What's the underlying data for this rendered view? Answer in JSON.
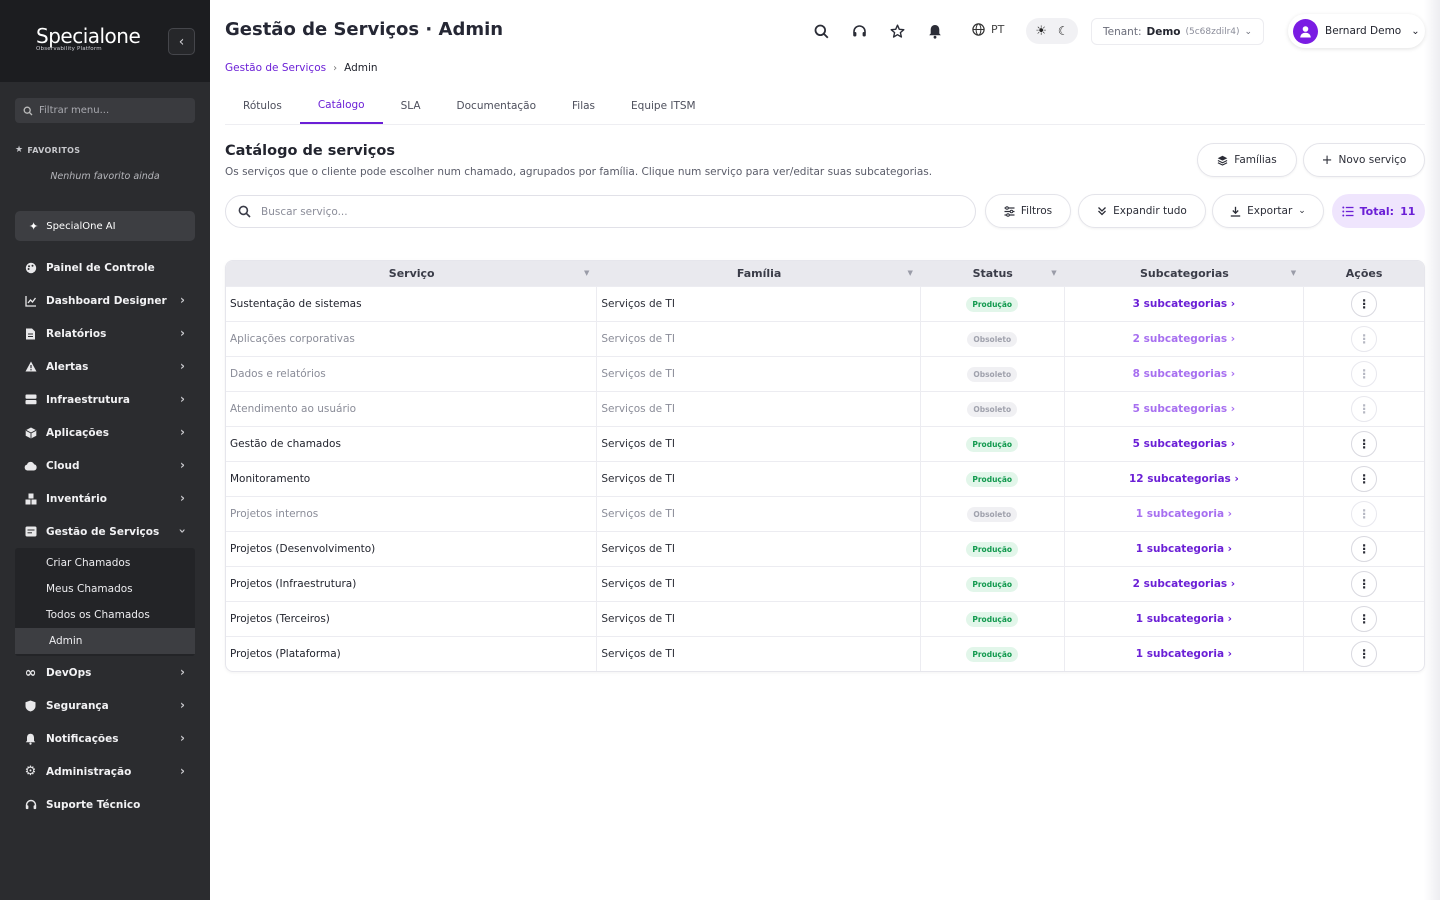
{
  "sidebar": {
    "logo_main": "Specialone",
    "logo_sub": "Observability Platform",
    "search_placeholder": "Filtrar menu...",
    "favorites_title": "FAVORITOS",
    "favorites_empty": "Nenhum favorito ainda",
    "ai_label": "SpecialOne AI",
    "items": [
      {
        "label": "Painel de Controle",
        "icon": "palette-icon",
        "chevron": false
      },
      {
        "label": "Dashboard Designer",
        "icon": "chart-line-icon",
        "chevron": true
      },
      {
        "label": "Relatórios",
        "icon": "file-icon",
        "chevron": true
      },
      {
        "label": "Alertas",
        "icon": "warning-icon",
        "chevron": true
      },
      {
        "label": "Infraestrutura",
        "icon": "server-icon",
        "chevron": true
      },
      {
        "label": "Aplicações",
        "icon": "box-icon",
        "chevron": true
      },
      {
        "label": "Cloud",
        "icon": "cloud-icon",
        "chevron": true
      },
      {
        "label": "Inventário",
        "icon": "boxes-icon",
        "chevron": true
      },
      {
        "label": "Gestão de Serviços",
        "icon": "service-icon",
        "chevron": true,
        "expanded": true
      }
    ],
    "sub_items": [
      {
        "label": "Criar Chamados"
      },
      {
        "label": "Meus Chamados"
      },
      {
        "label": "Todos os Chamados"
      },
      {
        "label": "Admin",
        "active": true
      }
    ],
    "items_after": [
      {
        "label": "DevOps",
        "icon": "infinity-icon"
      },
      {
        "label": "Segurança",
        "icon": "shield-icon"
      },
      {
        "label": "Notificações",
        "icon": "bell-icon"
      },
      {
        "label": "Administração",
        "icon": "gear-icon"
      },
      {
        "label": "Suporte Técnico",
        "icon": "headset-icon"
      }
    ]
  },
  "header": {
    "title": "Gestão de Serviços · Admin",
    "lang": "PT",
    "tenant_label": "Tenant:",
    "tenant_name": "Demo",
    "tenant_id": "(5c68zdilr4)",
    "user_name": "Bernard Demo"
  },
  "breadcrumb": {
    "parent": "Gestão de Serviços",
    "current": "Admin"
  },
  "tabs": [
    {
      "label": "Rótulos"
    },
    {
      "label": "Catálogo",
      "active": true
    },
    {
      "label": "SLA"
    },
    {
      "label": "Documentação"
    },
    {
      "label": "Filas"
    },
    {
      "label": "Equipe ITSM"
    }
  ],
  "section": {
    "title": "Catálogo de serviços",
    "description": "Os serviços que o cliente pode escolher num chamado, agrupados por família. Clique num serviço para ver/editar suas subcategorias.",
    "families_button": "Famílias",
    "new_button": "Novo serviço",
    "search_placeholder": "Buscar serviço...",
    "filters_button": "Filtros",
    "expand_button": "Expandir tudo",
    "export_button": "Exportar",
    "total_label": "Total:",
    "total_value": "11"
  },
  "table": {
    "headers": [
      "Serviço",
      "Família",
      "Status",
      "Subcategorias",
      "Ações"
    ],
    "rows": [
      {
        "name": "Sustentação de sistemas",
        "family": "Serviços de TI",
        "status": "Produção",
        "subs": "3 subcategorias ›",
        "dim": false
      },
      {
        "name": "Aplicações corporativas",
        "family": "Serviços de TI",
        "status": "Obsoleto",
        "subs": "2 subcategorias ›",
        "dim": true
      },
      {
        "name": "Dados e relatórios",
        "family": "Serviços de TI",
        "status": "Obsoleto",
        "subs": "8 subcategorias ›",
        "dim": true
      },
      {
        "name": "Atendimento ao usuário",
        "family": "Serviços de TI",
        "status": "Obsoleto",
        "subs": "5 subcategorias ›",
        "dim": true
      },
      {
        "name": "Gestão de chamados",
        "family": "Serviços de TI",
        "status": "Produção",
        "subs": "5 subcategorias ›",
        "dim": false
      },
      {
        "name": "Monitoramento",
        "family": "Serviços de TI",
        "status": "Produção",
        "subs": "12 subcategorias ›",
        "dim": false
      },
      {
        "name": "Projetos internos",
        "family": "Serviços de TI",
        "status": "Obsoleto",
        "subs": "1 subcategoria ›",
        "dim": true
      },
      {
        "name": "Projetos (Desenvolvimento)",
        "family": "Serviços de TI",
        "status": "Produção",
        "subs": "1 subcategoria ›",
        "dim": false
      },
      {
        "name": "Projetos (Infraestrutura)",
        "family": "Serviços de TI",
        "status": "Produção",
        "subs": "2 subcategorias ›",
        "dim": false
      },
      {
        "name": "Projetos (Terceiros)",
        "family": "Serviços de TI",
        "status": "Produção",
        "subs": "1 subcategoria ›",
        "dim": false
      },
      {
        "name": "Projetos (Plataforma)",
        "family": "Serviços de TI",
        "status": "Produção",
        "subs": "1 subcategoria ›",
        "dim": false
      }
    ]
  },
  "colors": {
    "accent": "#6b1fd6",
    "sidebar_bg": "#2b2c2f",
    "success": "#139a4f"
  }
}
